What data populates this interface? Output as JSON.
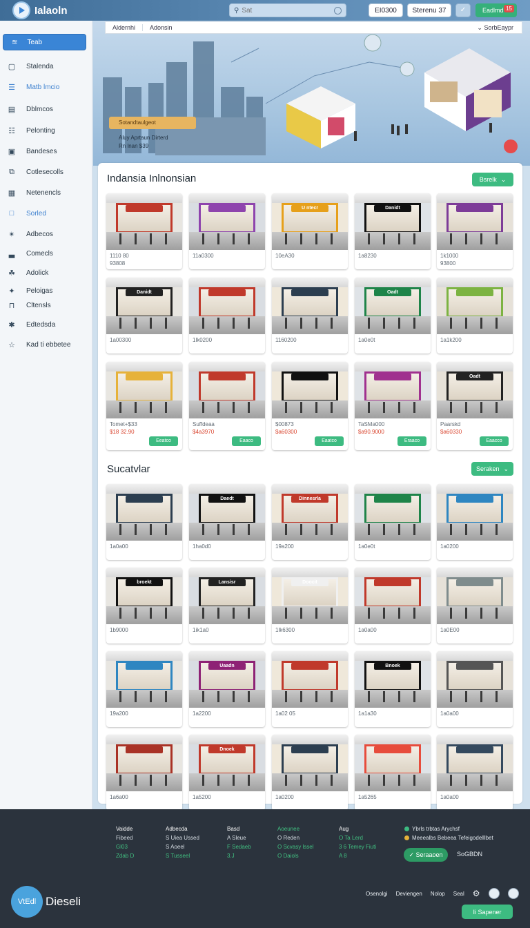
{
  "app": {
    "title": "Ialaoln"
  },
  "topbar": {
    "search_placeholder": "Sat",
    "btn1": "EI0300",
    "btn2": "Sterenu 37",
    "btn3": "Eadlmd",
    "badge": "15"
  },
  "breadcrumb": {
    "left1": "Aldernhi",
    "left2": "Adonsin",
    "right": "SorbEaypr"
  },
  "hero": {
    "banner": "Sotandtaulgeot",
    "sub1": "Aluy Aprtaun Dirterd",
    "sub2": "Rn lnan $39"
  },
  "sidebar": {
    "active": "Teab",
    "items": [
      {
        "label": "Stalenda",
        "icon": "square-icon"
      },
      {
        "label": "Matb lmcio",
        "icon": "cart-icon"
      },
      {
        "label": "Dblmcos",
        "icon": "grid-icon"
      },
      {
        "label": "Pelonting",
        "icon": "sliders-icon"
      },
      {
        "label": "Bandeses",
        "icon": "box-icon"
      },
      {
        "label": "Cotlesecolls",
        "icon": "copy-icon"
      },
      {
        "label": "Netenencls",
        "icon": "panel-icon"
      },
      {
        "label": "Sorled",
        "icon": "folder-icon"
      },
      {
        "label": "Adbecos",
        "icon": "rocket-icon"
      },
      {
        "label": "Comecls",
        "icon": "chart-icon"
      },
      {
        "label": "Adolick",
        "icon": "puzzle-icon"
      },
      {
        "label": "Peloigas",
        "icon": "share-icon"
      },
      {
        "label": "Cltensls",
        "icon": "folder-open-icon"
      },
      {
        "label": "Edtedsda",
        "icon": "gear-icon"
      },
      {
        "label": "Kad ti ebbetee",
        "icon": "star-icon"
      }
    ]
  },
  "section1": {
    "title": "Indansia Inlnonsian",
    "button": "Bsrelk",
    "cards": [
      {
        "code": "1110 80",
        "sub": "93808",
        "sign": "",
        "signColor": "#c0392b",
        "buy": ""
      },
      {
        "code": "11a0300",
        "sub": "",
        "sign": "",
        "signColor": "#8e44ad",
        "buy": ""
      },
      {
        "code": "10eA30",
        "sub": "",
        "sign": "U ntecr",
        "signColor": "#e6a01b",
        "buy": ""
      },
      {
        "code": "1a8230",
        "sub": "",
        "sign": "Danidt",
        "signColor": "#111111",
        "buy": ""
      },
      {
        "code": "1k1000",
        "sub": "93800",
        "sign": "",
        "signColor": "#7d3c98",
        "buy": ""
      },
      {
        "code": "1a00300",
        "sub": "",
        "sign": "Danidt",
        "signColor": "#222222",
        "buy": ""
      },
      {
        "code": "1lk0200",
        "sub": "",
        "sign": "",
        "signColor": "#c0392b",
        "buy": ""
      },
      {
        "code": "1160200",
        "sub": "",
        "sign": "",
        "signColor": "#2c3e50",
        "buy": ""
      },
      {
        "code": "1a0e0t",
        "sub": "",
        "sign": "Oadt",
        "signColor": "#1e8449",
        "buy": ""
      },
      {
        "code": "1a1k200",
        "sub": "",
        "sign": "",
        "signColor": "#7cb342",
        "buy": ""
      },
      {
        "code": "Tomet+$33",
        "sub": "$18 32.90",
        "sign": "",
        "signColor": "#e6b23a",
        "buy": "Eeatco"
      },
      {
        "code": "Suffdeaa",
        "sub": "$4a3970",
        "sign": "",
        "signColor": "#c0392b",
        "buy": "Eaaco"
      },
      {
        "code": "$00873",
        "sub": "$a60300",
        "sign": "",
        "signColor": "#111111",
        "buy": "Eaatco"
      },
      {
        "code": "TaSMa000",
        "sub": "$a90.9000",
        "sign": "",
        "signColor": "#a0318f",
        "buy": "Eraaco"
      },
      {
        "code": "Paarskd",
        "sub": "$a60330",
        "sign": "Oadt",
        "signColor": "#222222",
        "buy": "Eaacco"
      }
    ]
  },
  "section2": {
    "title": "Sucatvlar",
    "button": "Seraken",
    "cards": [
      {
        "code": "1a0a00",
        "sub": "",
        "sign": "",
        "signColor": "#2c3e50"
      },
      {
        "code": "1ha0d0",
        "sub": "",
        "sign": "Daedt",
        "signColor": "#111111"
      },
      {
        "code": "19a200",
        "sub": "",
        "sign": "Dinnesrla",
        "signColor": "#c0392b"
      },
      {
        "code": "1a0e0t",
        "sub": "",
        "sign": "",
        "signColor": "#1e8449"
      },
      {
        "code": "1a0200",
        "sub": "",
        "sign": "",
        "signColor": "#2e86c1"
      },
      {
        "code": "1b9000",
        "sub": "",
        "sign": "broekt",
        "signColor": "#111111"
      },
      {
        "code": "1ik1a0",
        "sub": "",
        "sign": "Lansisr",
        "signColor": "#222222"
      },
      {
        "code": "1lk6300",
        "sub": "",
        "sign": "Doocit",
        "signColor": "#f0f0f0"
      },
      {
        "code": "1a0a00",
        "sub": "",
        "sign": "",
        "signColor": "#c0392b"
      },
      {
        "code": "1a0E00",
        "sub": "",
        "sign": "",
        "signColor": "#7f8c8d"
      },
      {
        "code": "19a200",
        "sub": "",
        "sign": "",
        "signColor": "#2e86c1"
      },
      {
        "code": "1a2200",
        "sub": "",
        "sign": "Uaadn",
        "signColor": "#8e2275"
      },
      {
        "code": "1a02 05",
        "sub": "",
        "sign": "",
        "signColor": "#c0392b"
      },
      {
        "code": "1a1a30",
        "sub": "",
        "sign": "Bnoek",
        "signColor": "#111111"
      },
      {
        "code": "1a0a00",
        "sub": "",
        "sign": "",
        "signColor": "#555555"
      },
      {
        "code": "1a6a00",
        "sub": "",
        "sign": "",
        "signColor": "#a93226"
      },
      {
        "code": "1a5200",
        "sub": "",
        "sign": "Dnoek",
        "signColor": "#c0392b"
      },
      {
        "code": "1a0200",
        "sub": "",
        "sign": "",
        "signColor": "#2c3e50"
      },
      {
        "code": "1a5265",
        "sub": "",
        "sign": "",
        "signColor": "#e74c3c"
      },
      {
        "code": "1a0a00",
        "sub": "",
        "sign": "",
        "signColor": "#34495e"
      }
    ]
  },
  "footer": {
    "col1": [
      "Vaidde",
      "Fibeed",
      "Gl03",
      "Zdab D"
    ],
    "col2": [
      "Adbecda",
      "S Uiea Ussed",
      "S Aoeel",
      "S Tusseel"
    ],
    "col3": [
      "Basd",
      "A Sleue",
      "F Sedaeb",
      "3.J"
    ],
    "col4": [
      "Aoeunee",
      "O Reden",
      "O Scvasy lssel",
      "O Daiols"
    ],
    "col5": [
      "Aug",
      "O Ta Lerd",
      "3 6 Temey Fiuti",
      "A 8"
    ],
    "status1": "Ybrls trbtas Arychsf",
    "status2": "Meeealbs Bebeea Tefeigodelllbet",
    "subscribe": "Seraaoen",
    "sublabel": "SoGBDN"
  },
  "bottom": {
    "circle": "VtEdl",
    "brand": "Dieseli",
    "links": [
      "Osenolgi",
      "Deviengen",
      "Nolop",
      "Seal"
    ],
    "button": "Ii Sapener"
  },
  "colors": {
    "accent": "#3dbb81",
    "primary": "#3a85d6",
    "footer": "#2b333d"
  }
}
